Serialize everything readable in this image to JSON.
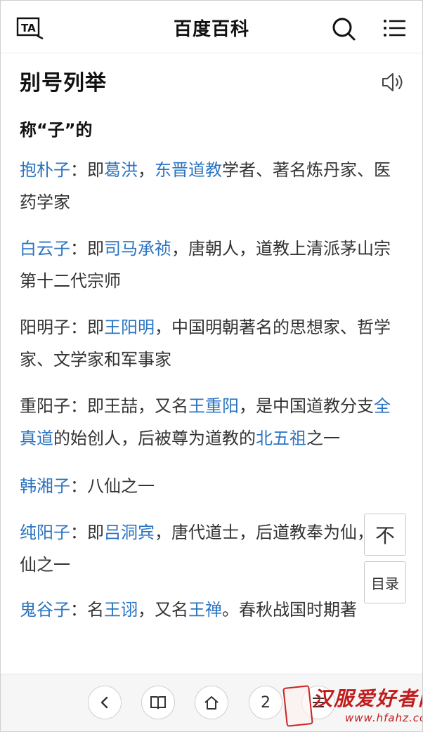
{
  "header": {
    "title": "百度百科",
    "icons": [
      "text-size-icon",
      "search-icon",
      "menu-icon"
    ]
  },
  "section": {
    "title": "别号列举"
  },
  "subheading": "称“子”的",
  "entries": [
    {
      "name": "抱朴子",
      "sep": "：即",
      "l1": "葛洪",
      "t1": "，",
      "l2": "东晋道教",
      "t2": "学者、著名炼丹家、医药学家"
    },
    {
      "name": "白云子",
      "sep": "：即",
      "l1": "司马承祯",
      "t1": "，唐朝人，道教上清派茅山宗第十二代宗师"
    },
    {
      "prefix": "阳明子：即",
      "l1": "王阳明",
      "t1": "，中国明朝著名的思想家、哲学家、文学家和军事家"
    },
    {
      "prefix": "重阳子：即王喆，又名",
      "l1": "王重阳",
      "t1": "，是中国道教分支",
      "l2": "全真道",
      "t2": "的始创人，后被尊为道教的",
      "l3": "北五祖",
      "t3": "之一"
    },
    {
      "name": "韩湘子",
      "t1": "：八仙之一"
    },
    {
      "name": "纯阳子",
      "sep": "：即",
      "l1": "吕洞宾",
      "t1": "，唐代道士，后道教奉为仙，八仙之一"
    },
    {
      "name": "鬼谷子",
      "sep": "：名",
      "l1": "王诩",
      "t1": "，又名",
      "l2": "王禅",
      "t2": "。春秋战国时期著"
    }
  ],
  "float_buttons": {
    "top_label": "不",
    "toc_label": "目录"
  },
  "bottom_bar": {
    "page_number": "2"
  },
  "watermark": {
    "name": "汉服爱好者网",
    "url": "www.hfahz.com"
  },
  "colors": {
    "link": "#2b74c1",
    "text": "#333333",
    "watermark": "#c21d1d"
  }
}
